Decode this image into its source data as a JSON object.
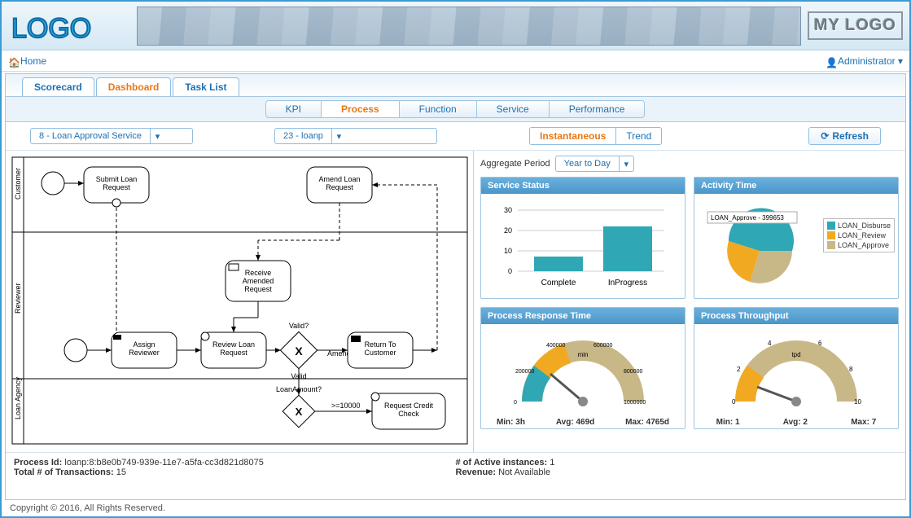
{
  "header": {
    "logo_left_text": "LOGO",
    "logo_right_text": "MY LOGO"
  },
  "topbar": {
    "home": "Home",
    "user": "Administrator"
  },
  "tabs": {
    "main": [
      {
        "label": "Scorecard",
        "active": false
      },
      {
        "label": "Dashboard",
        "active": true
      },
      {
        "label": "Task List",
        "active": false
      }
    ],
    "sub": [
      {
        "label": "KPI",
        "active": false
      },
      {
        "label": "Process",
        "active": true
      },
      {
        "label": "Function",
        "active": false
      },
      {
        "label": "Service",
        "active": false
      },
      {
        "label": "Performance",
        "active": false
      }
    ]
  },
  "filters": {
    "service_dd": "8 - Loan Approval Service",
    "process_dd": "23 - loanp",
    "mode": [
      {
        "label": "Instantaneous",
        "active": true
      },
      {
        "label": "Trend",
        "active": false
      }
    ],
    "refresh": "Refresh"
  },
  "bpmn": {
    "lanes": [
      "Customer",
      "Reviewer",
      "Loan Agency"
    ],
    "tasks": {
      "submit": "Submit Loan\nRequest",
      "amend": "Amend Loan\nRequest",
      "receive_amended": "Receive\nAmended\nRequest",
      "assign_reviewer": "Assign\nReviewer",
      "review_loan": "Review Loan\nRequest",
      "return_customer": "Return To\nCustomer",
      "request_credit": "Request Credit\nCheck"
    },
    "gateways": {
      "valid": {
        "top": "Valid?",
        "right": "Amend",
        "bottom": "Valid"
      },
      "amount": {
        "label": "LoanAmount?",
        "branch": ">=10000"
      }
    }
  },
  "aggregate": {
    "label": "Aggregate Period",
    "value": "Year to Day"
  },
  "cards": {
    "service_status": {
      "title": "Service Status",
      "chart_data": {
        "type": "bar",
        "categories": [
          "Complete",
          "InProgress"
        ],
        "values": [
          7,
          22
        ],
        "ylim": [
          0,
          30
        ],
        "yticks": [
          0,
          10,
          20,
          30
        ],
        "color": "#2fa7b5"
      }
    },
    "activity_time": {
      "title": "Activity Time",
      "tooltip": "LOAN_Approve - 399653",
      "chart_data": {
        "type": "pie",
        "series": [
          {
            "name": "LOAN_Disburse",
            "value": 45,
            "color": "#2fa7b5"
          },
          {
            "name": "LOAN_Review",
            "value": 15,
            "color": "#f2a922"
          },
          {
            "name": "LOAN_Approve",
            "value": 40,
            "color": "#c9b887"
          }
        ]
      }
    },
    "response_time": {
      "title": "Process Response Time",
      "unit": "min",
      "chart_data": {
        "type": "gauge",
        "ticks": [
          "0",
          "200000",
          "400000",
          "600000",
          "800000",
          "1000000"
        ],
        "value_pct": 0.28,
        "zones": [
          {
            "to": 0.2,
            "color": "#2fa7b5"
          },
          {
            "to": 0.4,
            "color": "#f2a922"
          },
          {
            "to": 1.0,
            "color": "#c9b887"
          }
        ]
      },
      "stats": {
        "min": "Min: 3h",
        "avg": "Avg: 469d",
        "max": "Max: 4765d"
      }
    },
    "throughput": {
      "title": "Process Throughput",
      "unit": "tpd",
      "chart_data": {
        "type": "gauge",
        "ticks": [
          "0",
          "2",
          "4",
          "6",
          "8",
          "10"
        ],
        "value_pct": 0.18,
        "zones": [
          {
            "to": 0.2,
            "color": "#f2a922"
          },
          {
            "to": 1.0,
            "color": "#c9b887"
          }
        ]
      },
      "stats": {
        "min": "Min: 1",
        "avg": "Avg: 2",
        "max": "Max: 7"
      }
    }
  },
  "stats": {
    "process_id_label": "Process Id:",
    "process_id": "loanp:8:b8e0b749-939e-11e7-a5fa-cc3d821d8075",
    "total_tx_label": "Total # of Transactions:",
    "total_tx": "15",
    "active_label": "# of Active instances:",
    "active": "1",
    "revenue_label": "Revenue:",
    "revenue": "Not Available"
  },
  "footer": "Copyright © 2016, All Rights Reserved.",
  "chart_data": [
    {
      "id": "service_status",
      "type": "bar",
      "categories": [
        "Complete",
        "InProgress"
      ],
      "values": [
        7,
        22
      ],
      "ylim": [
        0,
        30
      ]
    },
    {
      "id": "activity_time",
      "type": "pie",
      "series": [
        {
          "name": "LOAN_Disburse",
          "value": 45
        },
        {
          "name": "LOAN_Review",
          "value": 15
        },
        {
          "name": "LOAN_Approve",
          "value": 40
        }
      ]
    },
    {
      "id": "response_time",
      "type": "gauge",
      "min": 0,
      "max": 1000000,
      "value": 280000,
      "unit": "min"
    },
    {
      "id": "throughput",
      "type": "gauge",
      "min": 0,
      "max": 10,
      "value": 1.8,
      "unit": "tpd"
    }
  ]
}
